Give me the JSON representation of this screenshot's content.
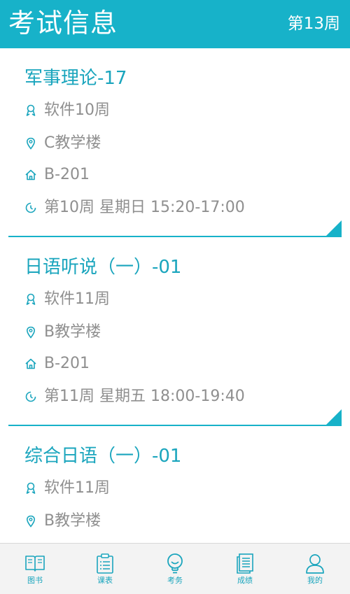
{
  "header": {
    "title": "考试信息",
    "week": "第13周"
  },
  "exams": [
    {
      "name": "军事理论-17",
      "week": "软件10周",
      "building": "C教学楼",
      "room": "B-201",
      "time": "第10周 星期日 15:20-17:00"
    },
    {
      "name": "日语听说（一）-01",
      "week": "软件11周",
      "building": "B教学楼",
      "room": "B-201",
      "time": "第11周 星期五 18:00-19:40"
    },
    {
      "name": "综合日语（一）-01",
      "week": "软件11周",
      "building": "B教学楼",
      "room": "",
      "time": ""
    }
  ],
  "tabs": [
    {
      "label": "图书",
      "icon": "book-icon"
    },
    {
      "label": "课表",
      "icon": "clipboard-icon"
    },
    {
      "label": "考务",
      "icon": "lightbulb-icon"
    },
    {
      "label": "成绩",
      "icon": "report-icon"
    },
    {
      "label": "我的",
      "icon": "person-icon"
    }
  ],
  "colors": {
    "accent": "#17b2c9",
    "text_gray": "#8f8f8f",
    "tab_bg": "#f3f3f3"
  }
}
